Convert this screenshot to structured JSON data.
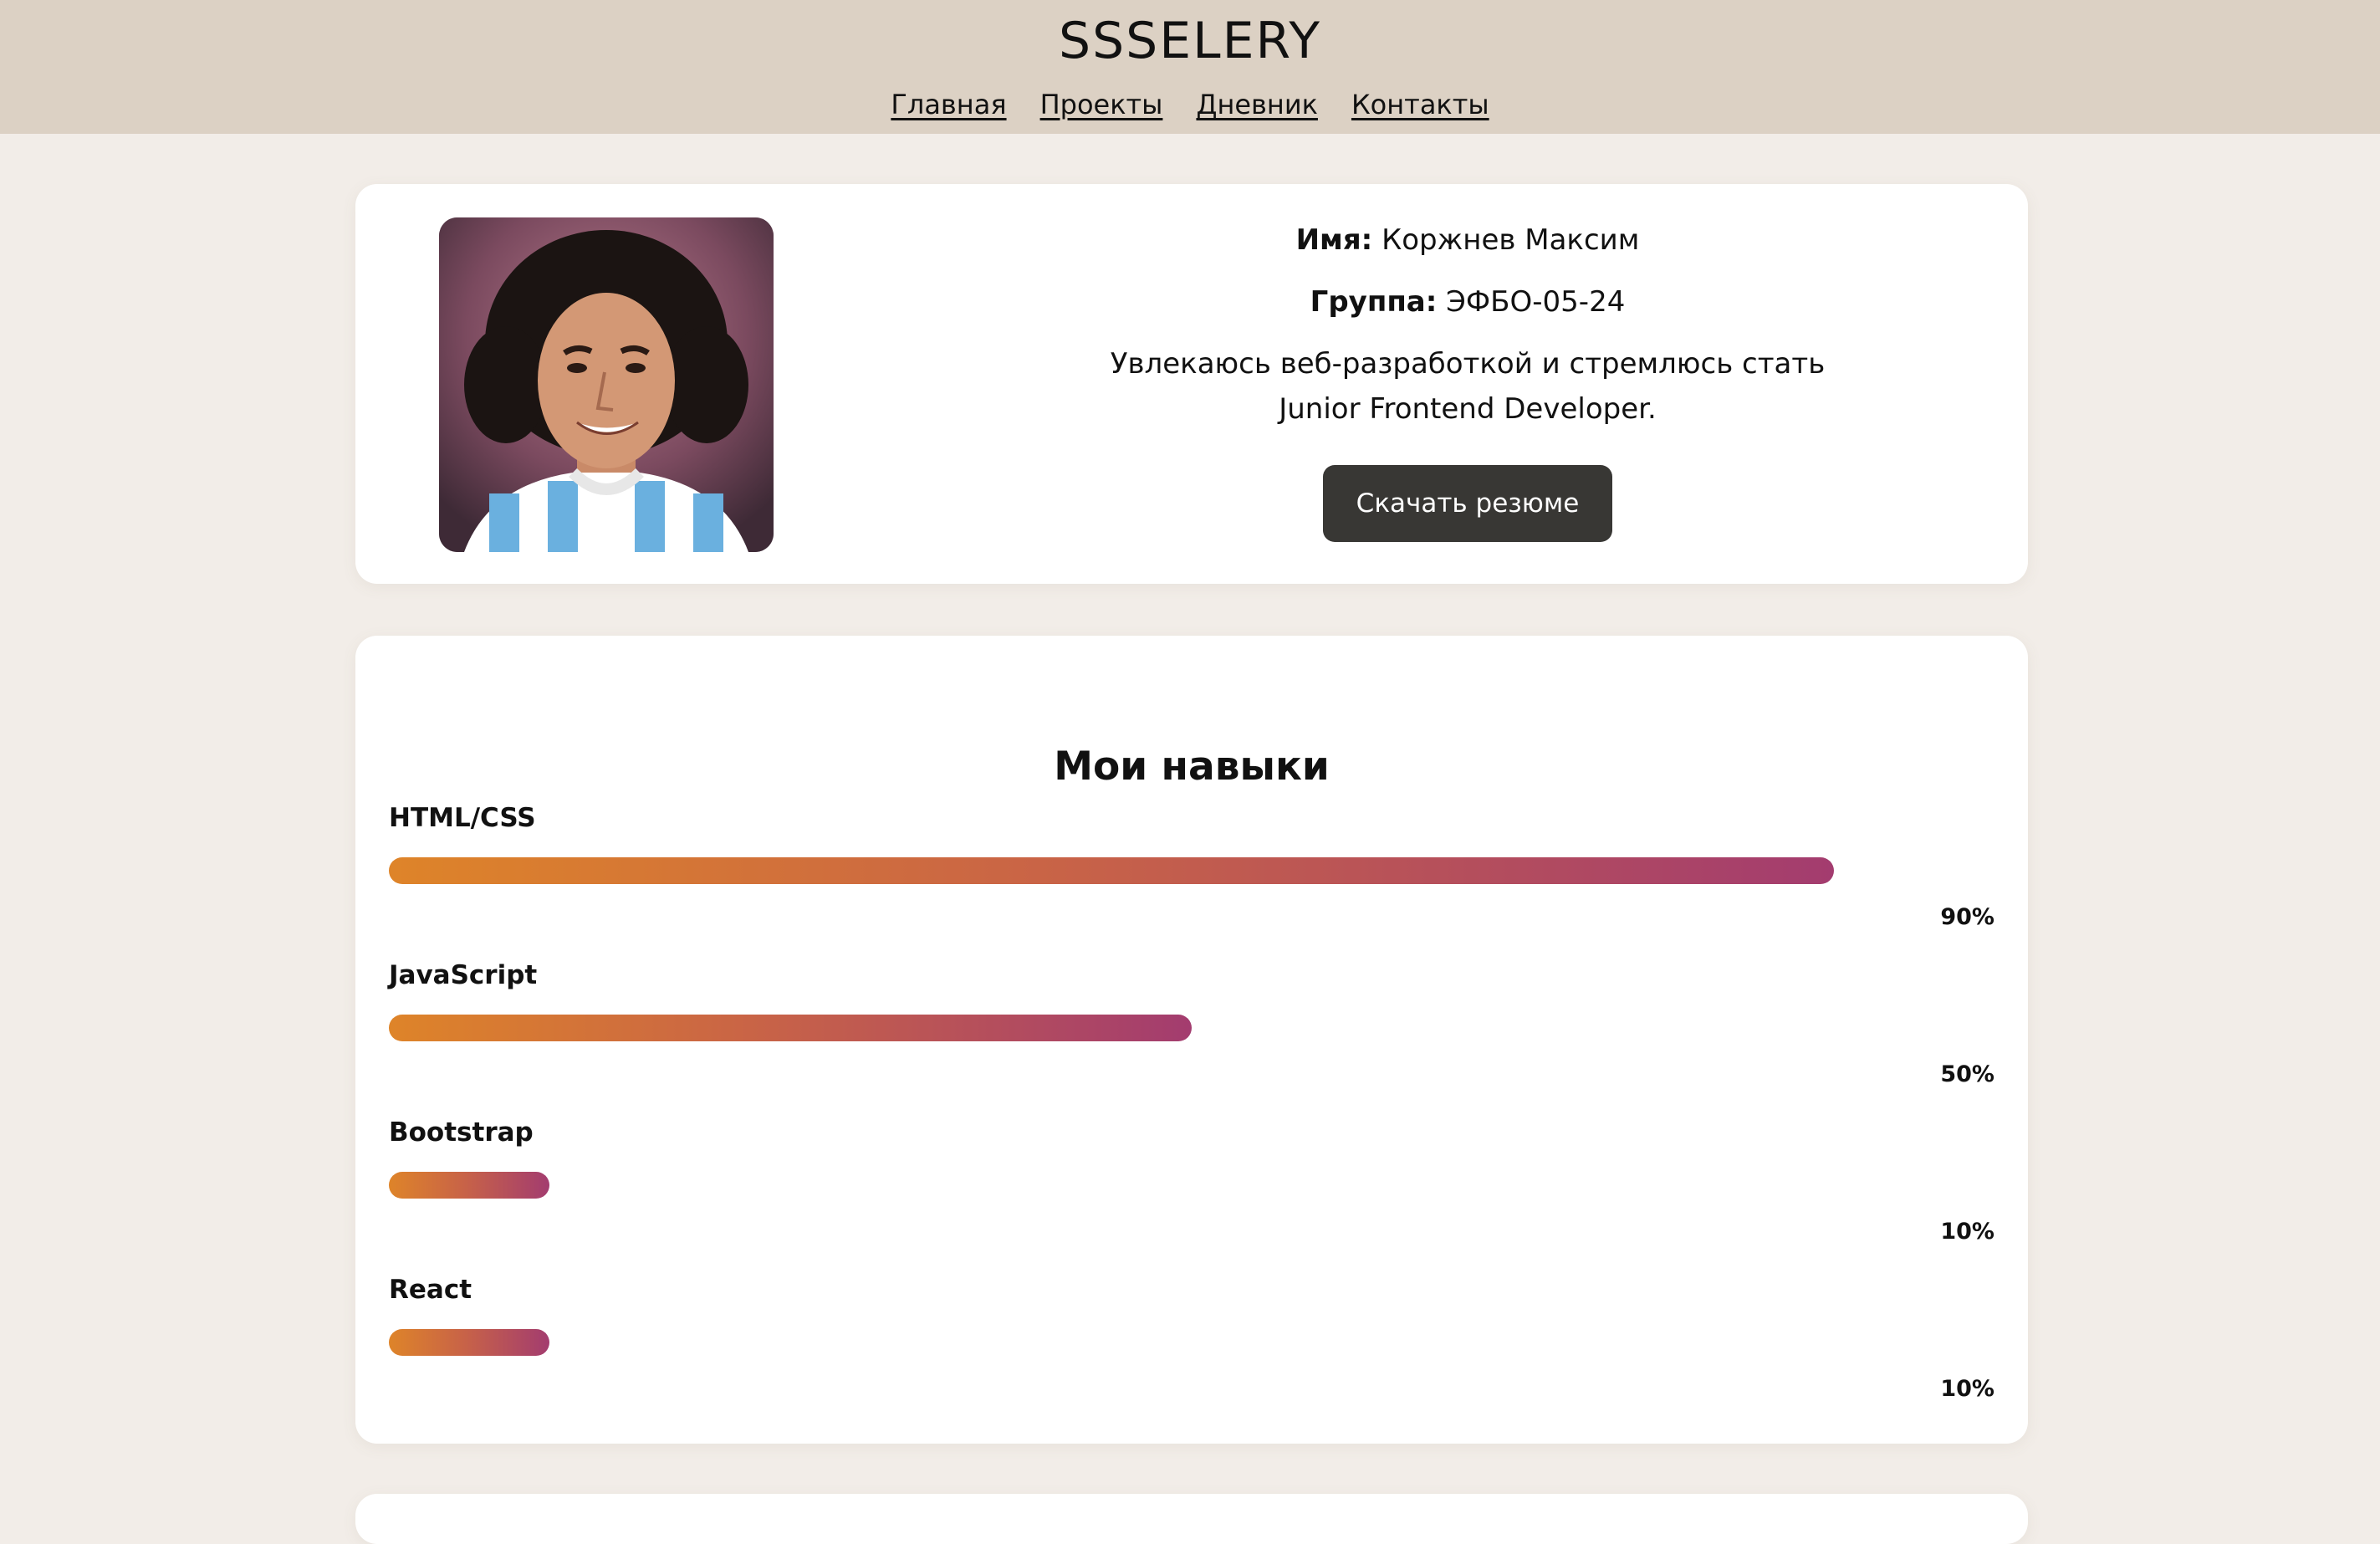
{
  "header": {
    "site_title": "SSSELERY",
    "nav": [
      {
        "label": "Главная"
      },
      {
        "label": "Проекты"
      },
      {
        "label": "Дневник"
      },
      {
        "label": "Контакты"
      }
    ]
  },
  "profile": {
    "name_label": "Имя:",
    "name_value": "Коржнев Максим",
    "group_label": "Группа:",
    "group_value": "ЭФБО-05-24",
    "about": "Увлекаюсь веб-разработкой и стремлюсь стать Junior Frontend Developer.",
    "download_button": "Скачать резюме"
  },
  "skills": {
    "title": "Мои навыки",
    "items": [
      {
        "name": "HTML/CSS",
        "percent_label": "90%",
        "level": 0.9
      },
      {
        "name": "JavaScript",
        "percent_label": "50%",
        "level": 0.5
      },
      {
        "name": "Bootstrap",
        "percent_label": "10%",
        "level": 0.1
      },
      {
        "name": "React",
        "percent_label": "10%",
        "level": 0.1
      }
    ]
  },
  "colors": {
    "header_bg": "#dcd1c4",
    "page_bg": "#f2ede8",
    "button_bg": "#383734",
    "bar_gradient_start": "#de8429",
    "bar_gradient_end": "#a33c6f"
  }
}
